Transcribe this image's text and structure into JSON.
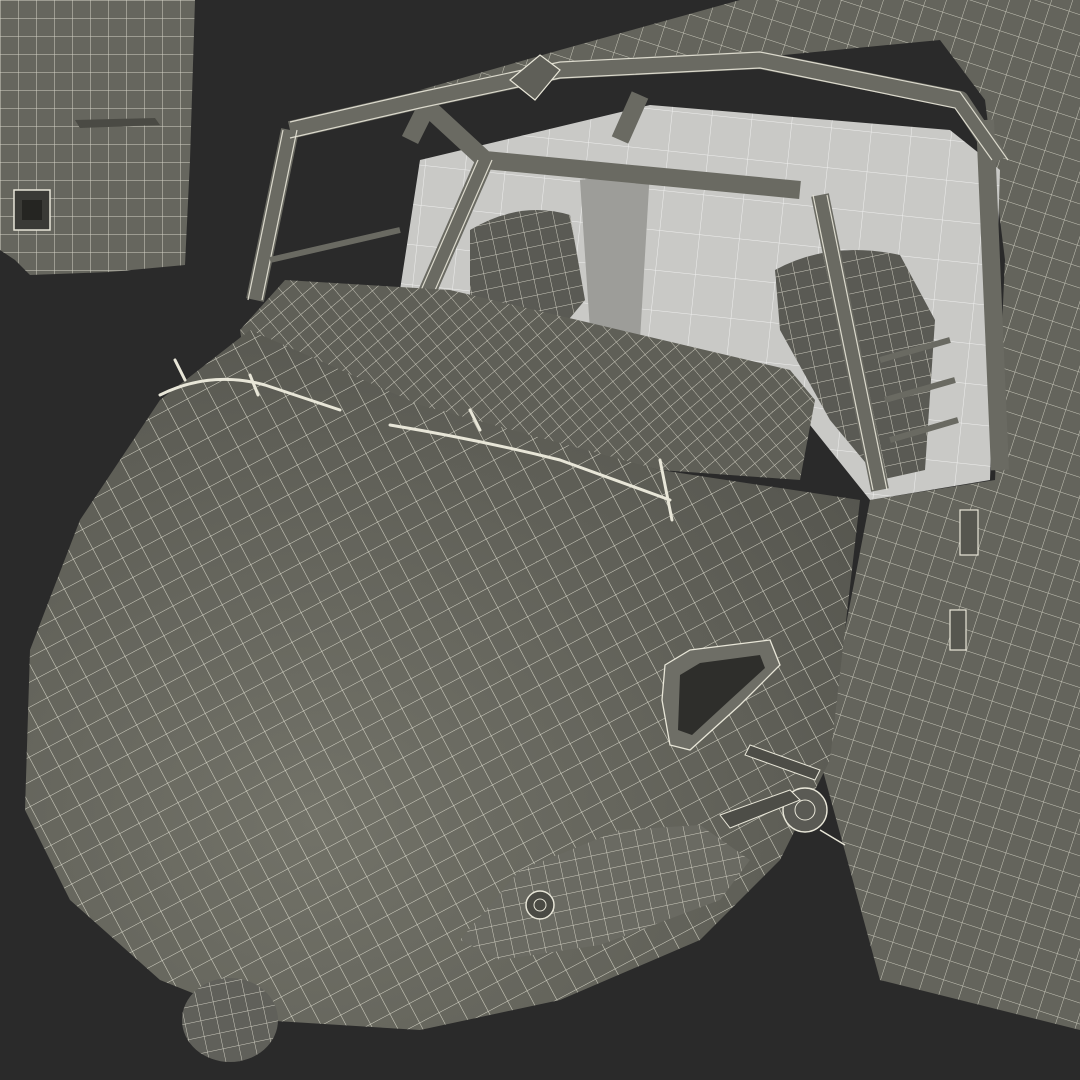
{
  "scene": {
    "subject": "aircraft-cockpit-wireframe",
    "colors": {
      "background": "#2a2a2a",
      "hull": "#64645c",
      "hull_light": "#727268",
      "hull_dark": "#4f4f49",
      "wire": "#e8e6d8",
      "interior": "#c9c9c6",
      "interior_dark": "#9d9d99"
    }
  }
}
